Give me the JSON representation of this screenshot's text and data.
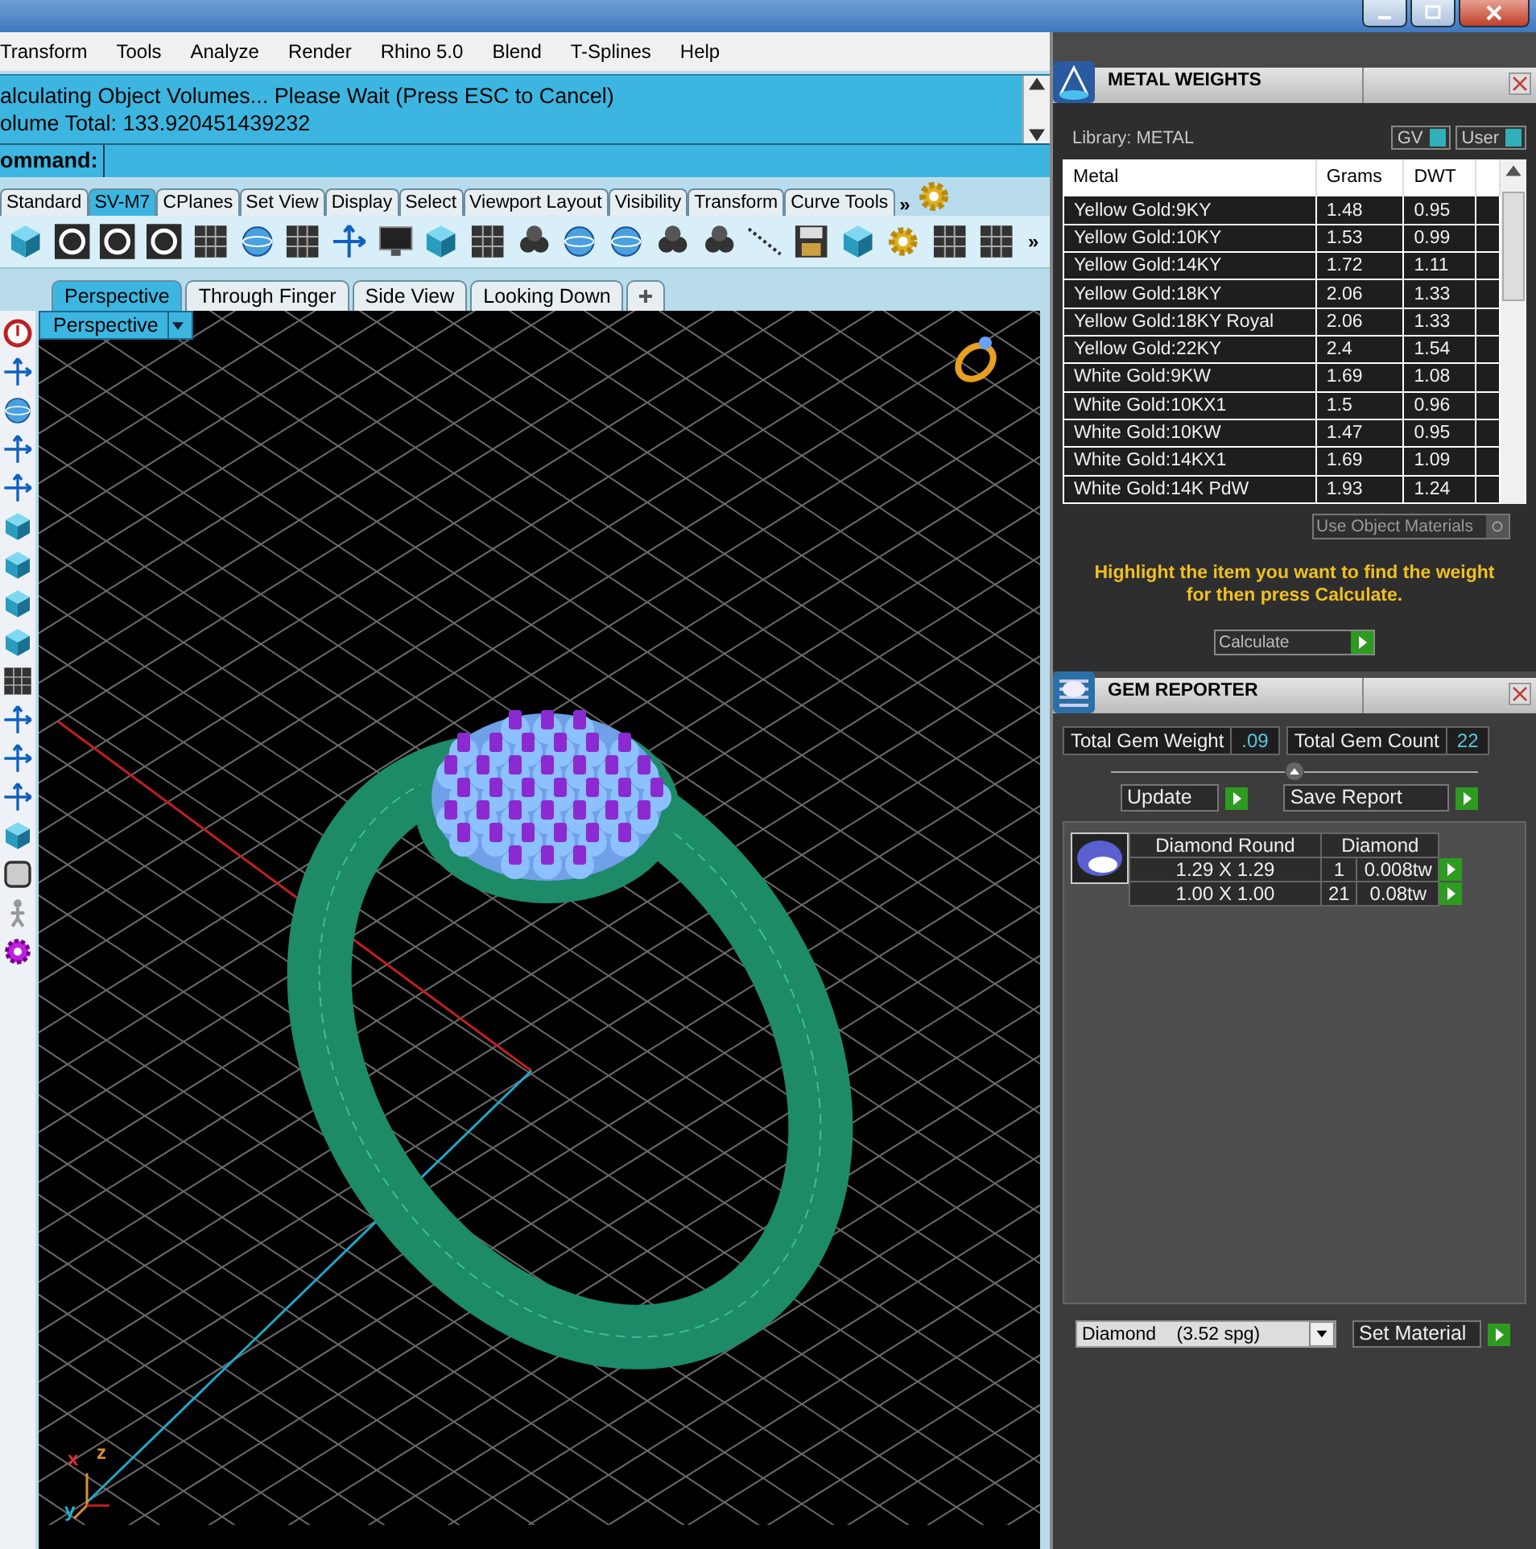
{
  "menu": [
    "Transform",
    "Tools",
    "Analyze",
    "Render",
    "Rhino 5.0",
    "Blend",
    "T-Splines",
    "Help"
  ],
  "command_area": {
    "lines": [
      "alculating Object Volumes... Please Wait (Press ESC to Cancel)",
      "olume Total: 133.920451439232"
    ],
    "prompt": "ommand:"
  },
  "toolbar_tabs": [
    {
      "label": "Standard",
      "selected": false
    },
    {
      "label": "SV-M7",
      "selected": true
    },
    {
      "label": "CPlanes",
      "selected": false
    },
    {
      "label": "Set View",
      "selected": false
    },
    {
      "label": "Display",
      "selected": false
    },
    {
      "label": "Select",
      "selected": false
    },
    {
      "label": "Viewport Layout",
      "selected": false
    },
    {
      "label": "Visibility",
      "selected": false
    },
    {
      "label": "Transform",
      "selected": false
    },
    {
      "label": "Curve Tools",
      "selected": false
    }
  ],
  "tabs_overflow": "»",
  "toolbar_overflow": "»",
  "viewport_tabs": [
    {
      "label": "Perspective",
      "selected": true
    },
    {
      "label": "Through Finger",
      "selected": false
    },
    {
      "label": "Side View",
      "selected": false
    },
    {
      "label": "Looking Down",
      "selected": false
    }
  ],
  "viewport": {
    "label": "Perspective",
    "axis_labels": [
      "x",
      "z",
      "y"
    ]
  },
  "metal_weights": {
    "title": "METAL WEIGHTS",
    "library": "Library: METAL",
    "toggles": [
      {
        "label": "GV",
        "on": true
      },
      {
        "label": "User",
        "on": true
      }
    ],
    "columns": [
      "Metal",
      "Grams",
      "DWT"
    ],
    "rows": [
      [
        "Yellow Gold:9KY",
        "1.48",
        "0.95"
      ],
      [
        "Yellow Gold:10KY",
        "1.53",
        "0.99"
      ],
      [
        "Yellow Gold:14KY",
        "1.72",
        "1.11"
      ],
      [
        "Yellow Gold:18KY",
        "2.06",
        "1.33"
      ],
      [
        "Yellow Gold:18KY Royal",
        "2.06",
        "1.33"
      ],
      [
        "Yellow Gold:22KY",
        "2.4",
        "1.54"
      ],
      [
        "White Gold:9KW",
        "1.69",
        "1.08"
      ],
      [
        "White Gold:10KX1",
        "1.5",
        "0.96"
      ],
      [
        "White Gold:10KW",
        "1.47",
        "0.95"
      ],
      [
        "White Gold:14KX1",
        "1.69",
        "1.09"
      ],
      [
        "White Gold:14K PdW",
        "1.93",
        "1.24"
      ]
    ],
    "use_object_materials": {
      "label": "Use Object Materials",
      "on": false
    },
    "hint": "Highlight the item you want to find the weight for then press Calculate.",
    "calculate": "Calculate"
  },
  "gem_reporter": {
    "title": "GEM REPORTER",
    "stats": [
      {
        "label": "Total Gem Weight",
        "value": ".09"
      },
      {
        "label": "Total Gem Count",
        "value": "22"
      }
    ],
    "update": "Update",
    "save_report": "Save Report",
    "table": {
      "size_heading": "Diamond Round",
      "stone_heading": "Diamond",
      "rows": [
        [
          "1.29 X 1.29",
          "1",
          "0.008tw"
        ],
        [
          "1.00 X 1.00",
          "21",
          "0.08tw"
        ]
      ]
    },
    "material": "Diamond    (3.52 spg)",
    "set_material": "Set Material"
  }
}
